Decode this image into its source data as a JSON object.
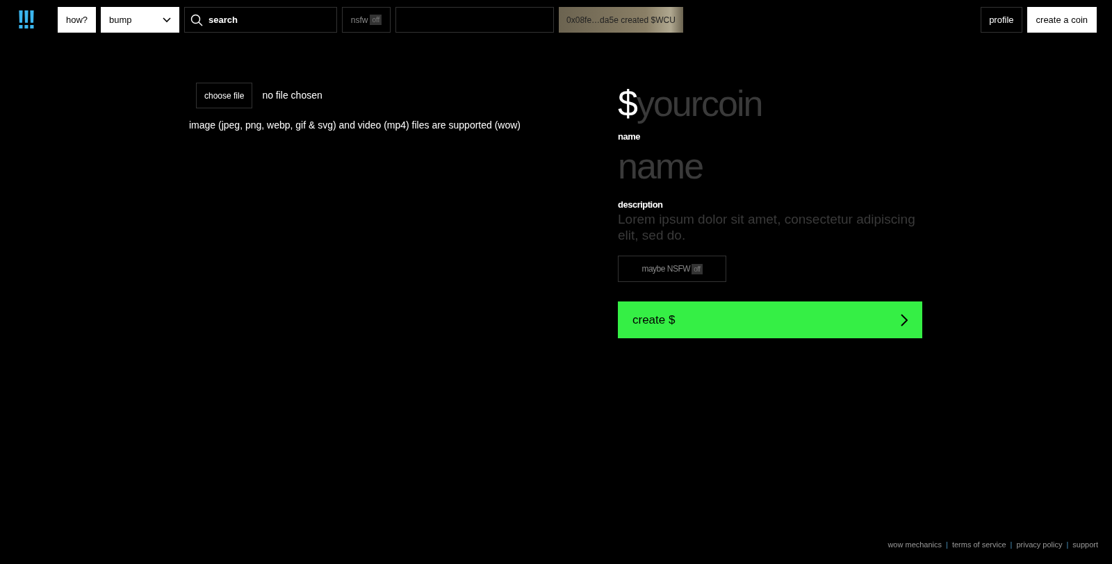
{
  "header": {
    "logo": "!!!",
    "how_button": "how?",
    "sort_dropdown": {
      "value": "bump"
    },
    "search": {
      "placeholder": "search"
    },
    "nsfw_toggle": {
      "label": "nsfw",
      "badge": "off"
    },
    "ticker_text": "0x08fe…da5e created $WCU",
    "profile_button": "profile",
    "create_button": "create a coin"
  },
  "upload": {
    "button": "choose file",
    "status": "no file chosen",
    "hint": "image (jpeg, png, webp, gif & svg) and video (mp4) files are supported (wow)"
  },
  "form": {
    "ticker": {
      "prefix": "$",
      "placeholder": "yourcoin"
    },
    "name": {
      "label": "name",
      "placeholder": "name"
    },
    "description": {
      "label": "description",
      "placeholder": "Lorem ipsum dolor sit amet, consectetur adipiscing elit, sed do."
    },
    "nsfw_button": {
      "label": "maybe NSFW",
      "badge": "off"
    },
    "submit": "create $"
  },
  "footer": [
    {
      "kind": "link",
      "text": "wow mechanics"
    },
    {
      "kind": "separator",
      "text": "|"
    },
    {
      "kind": "link",
      "text": "terms of service"
    },
    {
      "kind": "separator",
      "text": "|"
    },
    {
      "kind": "link",
      "text": "privacy policy"
    },
    {
      "kind": "separator",
      "text": "|"
    },
    {
      "kind": "link",
      "text": "support"
    }
  ]
}
